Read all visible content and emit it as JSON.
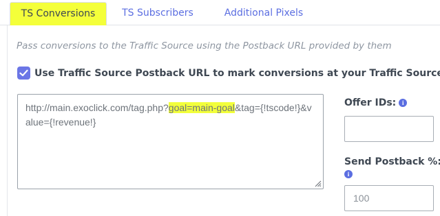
{
  "tabs": {
    "conversions": "TS Conversions",
    "subscribers": "TS Subscribers",
    "pixels": "Additional Pixels"
  },
  "description": "Pass conversions to the Traffic Source using the Postback URL provided by them",
  "checkbox": {
    "label": "Use Traffic Source Postback URL to mark conversions at your Traffic Source",
    "checked": true
  },
  "postback_url": {
    "prefix": "http://main.exoclick.com/tag.php?",
    "highlight": "goal=main-goal",
    "suffix": "&tag={!tscode!}&value={!revenue!}"
  },
  "offer_ids": {
    "label": "Offer IDs:",
    "value": ""
  },
  "send_postback": {
    "label": "Send Postback %:",
    "value": "100"
  },
  "colors": {
    "accent": "#5b6ee1",
    "highlight": "#f4ff3a",
    "checkbox": "#6b76e6"
  },
  "icons": {
    "info": "info-circle-icon",
    "check": "check-icon",
    "resize": "resize-grip-icon"
  }
}
